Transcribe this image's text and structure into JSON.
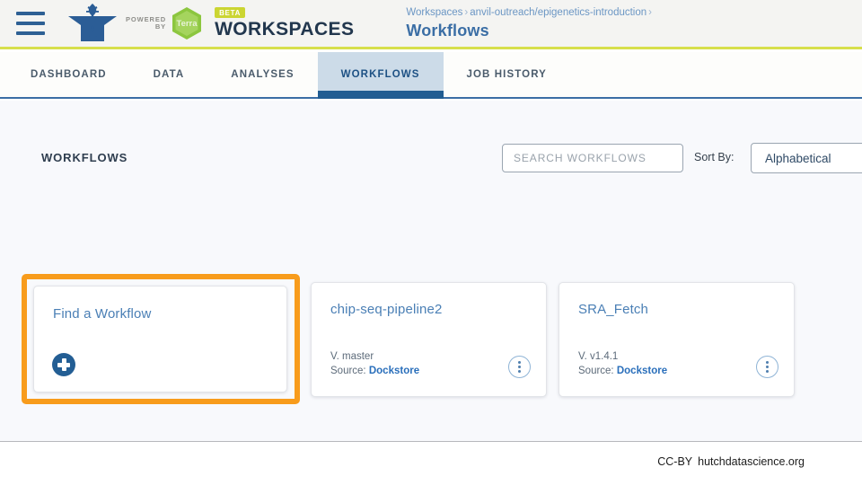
{
  "header": {
    "menu_icon": "hamburger-menu-icon",
    "logo_icon": "anvil-logo-icon",
    "powered_line1": "POWERED",
    "powered_line2": "BY",
    "terra_label": "Terra",
    "beta_badge": "BETA",
    "product_title": "WORKSPACES",
    "breadcrumb": {
      "root": "Workspaces",
      "separator": "›",
      "workspace": "anvil-outreach/epigenetics-introduction",
      "current": "Workflows"
    }
  },
  "tabs": [
    {
      "label": "DASHBOARD",
      "active": false
    },
    {
      "label": "DATA",
      "active": false
    },
    {
      "label": "ANALYSES",
      "active": false
    },
    {
      "label": "WORKFLOWS",
      "active": true
    },
    {
      "label": "JOB HISTORY",
      "active": false
    }
  ],
  "toolbar": {
    "section_title": "WORKFLOWS",
    "search_placeholder": "SEARCH WORKFLOWS",
    "search_value": "",
    "sort_label": "Sort By:",
    "sort_value": "Alphabetical"
  },
  "cards": [
    {
      "title": "Find a Workflow",
      "type": "add",
      "add_icon": "plus-circle-icon",
      "highlighted": true
    },
    {
      "title": "chip-seq-pipeline2",
      "type": "workflow",
      "version": "V. master",
      "source_label": "Source:",
      "source_name": "Dockstore",
      "menu_icon": "kebab-menu-icon"
    },
    {
      "title": "SRA_Fetch",
      "type": "workflow",
      "version": "V. v1.4.1",
      "source_label": "Source:",
      "source_name": "Dockstore",
      "menu_icon": "kebab-menu-icon"
    }
  ],
  "footer": {
    "license": "CC-BY",
    "site": "hutchdatascience.org"
  },
  "colors": {
    "accent_blue": "#235e94",
    "link_blue": "#2a6fbb",
    "highlight_orange": "#f89c1c",
    "terra_green": "#7cb342",
    "beta_green": "#cbd532",
    "header_bg": "#f4f4f2",
    "main_bg": "#f8f9fc",
    "active_tab_bg": "#ccdbe8"
  }
}
